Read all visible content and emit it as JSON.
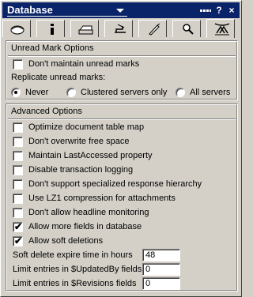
{
  "window": {
    "title": "Database",
    "help_label": "?",
    "close_label": "×"
  },
  "tabs": [
    {
      "icon": "database-properties-icon",
      "active": false
    },
    {
      "icon": "info-icon",
      "active": false
    },
    {
      "icon": "printer-icon",
      "active": false
    },
    {
      "icon": "design-icon",
      "active": false
    },
    {
      "icon": "launch-icon",
      "active": false
    },
    {
      "icon": "search-icon",
      "active": false
    },
    {
      "icon": "advanced-icon",
      "active": true
    }
  ],
  "unread": {
    "title": "Unread Mark Options",
    "dont_maintain": {
      "label": "Don't maintain unread marks",
      "checked": false
    },
    "replicate_label": "Replicate unread marks:",
    "options": [
      {
        "label": "Never",
        "selected": true
      },
      {
        "label": "Clustered servers only",
        "selected": false
      },
      {
        "label": "All servers",
        "selected": false
      }
    ]
  },
  "advanced": {
    "title": "Advanced Options",
    "options": [
      {
        "label": "Optimize document table map",
        "checked": false
      },
      {
        "label": "Don't overwrite free space",
        "checked": false
      },
      {
        "label": "Maintain LastAccessed property",
        "checked": false
      },
      {
        "label": "Disable transaction logging",
        "checked": false
      },
      {
        "label": "Don't support specialized response hierarchy",
        "checked": false
      },
      {
        "label": "Use LZ1 compression for attachments",
        "checked": false
      },
      {
        "label": "Don't allow headline monitoring",
        "checked": false
      },
      {
        "label": "Allow more fields in database",
        "checked": true
      },
      {
        "label": "Allow soft deletions",
        "checked": true
      }
    ],
    "fields": [
      {
        "label": "Soft delete expire time in hours",
        "value": "48"
      },
      {
        "label": "Limit entries in $UpdatedBy fields",
        "value": "0"
      },
      {
        "label": "Limit entries in $Revisions fields",
        "value": "0"
      }
    ]
  },
  "check_glyph": "✔"
}
